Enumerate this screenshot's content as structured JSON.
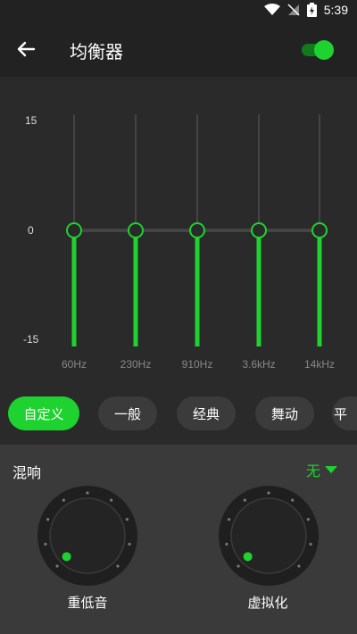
{
  "status": {
    "time": "5:39"
  },
  "header": {
    "title": "均衡器",
    "enabled": true
  },
  "equalizer": {
    "y_labels": {
      "max": "15",
      "mid": "0",
      "min": "-15"
    },
    "bands": [
      {
        "freq": "60Hz",
        "gain_db": 0
      },
      {
        "freq": "230Hz",
        "gain_db": 0
      },
      {
        "freq": "910Hz",
        "gain_db": 0
      },
      {
        "freq": "3.6kHz",
        "gain_db": 0
      },
      {
        "freq": "14kHz",
        "gain_db": 0
      }
    ]
  },
  "presets": {
    "items": [
      "自定义",
      "一般",
      "经典",
      "舞动",
      "平"
    ],
    "selected": "自定义"
  },
  "reverb": {
    "label": "混响",
    "value": "无"
  },
  "knobs": [
    {
      "label": "重低音",
      "level": 0
    },
    {
      "label": "虚拟化",
      "level": 0
    }
  ],
  "colors": {
    "accent": "#1ed22f",
    "background": "#2a2a2a",
    "panel": "#3a3a3a",
    "chip": "#3b3b3b"
  }
}
